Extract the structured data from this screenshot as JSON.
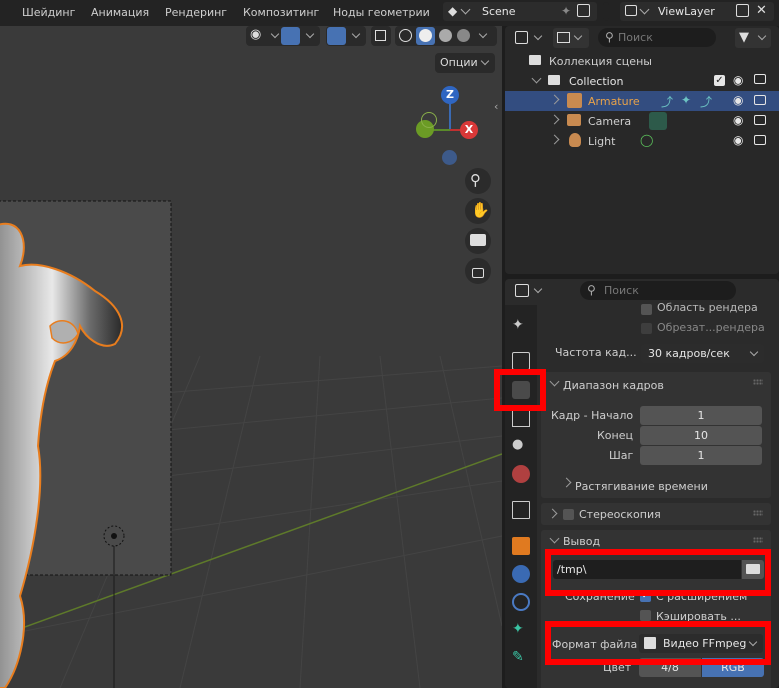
{
  "menu": [
    "Шейдинг",
    "Анимация",
    "Рендеринг",
    "Композитинг",
    "Ноды геометрии"
  ],
  "scene": {
    "name": "Scene"
  },
  "view_layer": {
    "name": "ViewLayer"
  },
  "viewport": {
    "options_label": "Опции"
  },
  "gizmo": {
    "z": "Z",
    "x": "X"
  },
  "outliner": {
    "search_placeholder": "Поиск",
    "root_label": "Коллекция сцены",
    "collection_label": "Collection",
    "items": [
      {
        "label": "Armature",
        "selected": true,
        "color": "#e8a24a"
      },
      {
        "label": "Camera",
        "selected": false,
        "color": "#cfcfcf"
      },
      {
        "label": "Light",
        "selected": false,
        "color": "#cfcfcf"
      }
    ]
  },
  "properties": {
    "search_placeholder": "Поиск",
    "render_region_label": "Область рендера",
    "crop_region_label": "Обрезат...рендера",
    "frame_rate_label": "Частота кад...",
    "frame_rate_value": "30 кадров/сек",
    "frame_range": {
      "header": "Диапазон кадров",
      "start_label": "Кадр - Начало",
      "start_value": "1",
      "end_label": "Конец",
      "end_value": "10",
      "step_label": "Шаг",
      "step_value": "1",
      "time_stretch_label": "Растягивание времени"
    },
    "stereoscopy_label": "Стереоскопия",
    "output": {
      "header": "Вывод",
      "path_value": "/tmp\\",
      "saving_label": "Сохранение",
      "extension_label": "С расширением",
      "cache_label": "Кэшировать ...",
      "file_format_label": "Формат файла",
      "file_format_value": "Видео FFmpeg",
      "color_label": "Цвет",
      "color_options": [
        "4/8",
        "RGB"
      ]
    }
  },
  "colors": {
    "highlight": "#ff0000",
    "selection": "#334d80",
    "accent_blue": "#4772b3",
    "outline_orange": "#e87d1e"
  }
}
